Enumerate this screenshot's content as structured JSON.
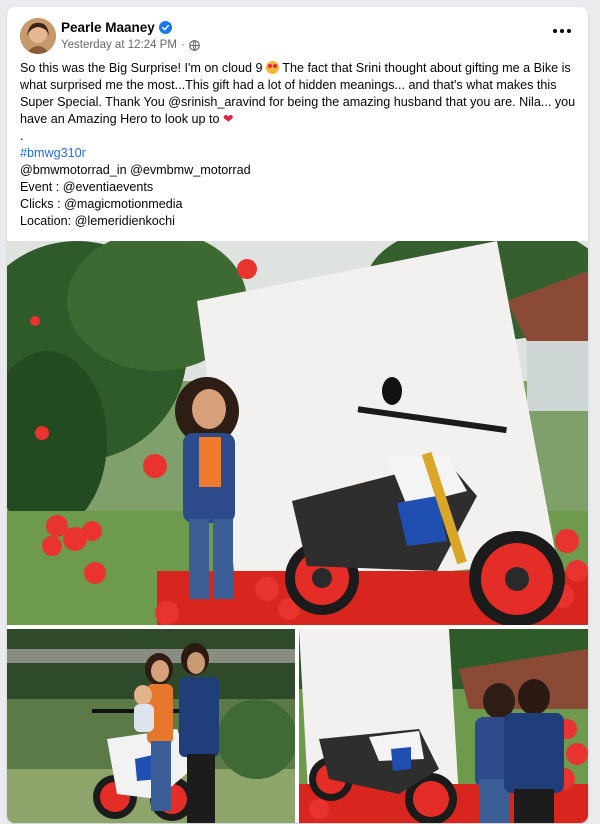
{
  "post": {
    "author": "Pearle Maaney",
    "timestamp": "Yesterday at 12:24 PM",
    "separator": "·",
    "text_line1": "So this was the Big Surprise! I'm on cloud 9",
    "text_line1b": "The fact that Srini thought about gifting me a Bike is what surprised me the most...This  gift had a lot of hidden meanings... and that's what makes this Super Special. Thank You @srinish_aravind for being the amazing husband that you are. Nila... you have an Amazing Hero to look up to",
    "heart": "❤",
    "dot": ".",
    "hashtag": "#bmwg310r",
    "mentions": "@bmwmotorrad_in @evmbmw_motorrad",
    "event": "Event : @eventiaevents",
    "clicks": "Clicks : @magicmotionmedia",
    "location": "Location: @lemeridienkochi"
  },
  "icons": {
    "verified": "verified-badge-icon",
    "privacy": "globe-icon",
    "more": "more-options-icon"
  },
  "colors": {
    "verified_blue": "#1877f2",
    "link_blue": "#216fdb",
    "heart_red": "#e41e3f",
    "balloon_red": "#e8332f"
  }
}
